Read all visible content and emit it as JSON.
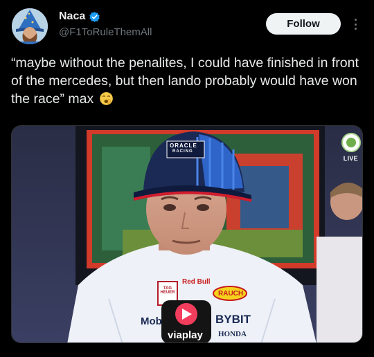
{
  "author": {
    "display_name": "Naca",
    "handle": "@F1ToRuleThemAll",
    "verified": true
  },
  "follow_label": "Follow",
  "tweet": {
    "text": "“maybe without the penalites, I could have finished in front of the mercedes, but then lando probably would have won the race” max",
    "emoji": "shushing-face"
  },
  "media": {
    "live_label": "LIVE",
    "cap_brand": "ORACLE",
    "cap_sub": "RACING",
    "sponsors": {
      "redbull": "Red Bull",
      "tag": "TAG HEUER",
      "rauch": "RAUCH",
      "bybit": "BYBIT",
      "honda": "HONDA",
      "mobil": "Mob",
      "mic": "viaplay"
    }
  },
  "colors": {
    "background": "#000000",
    "text": "#e7e9ea",
    "muted": "#71767b",
    "verified": "#1d9bf0",
    "follow_bg": "#eff3f4"
  }
}
